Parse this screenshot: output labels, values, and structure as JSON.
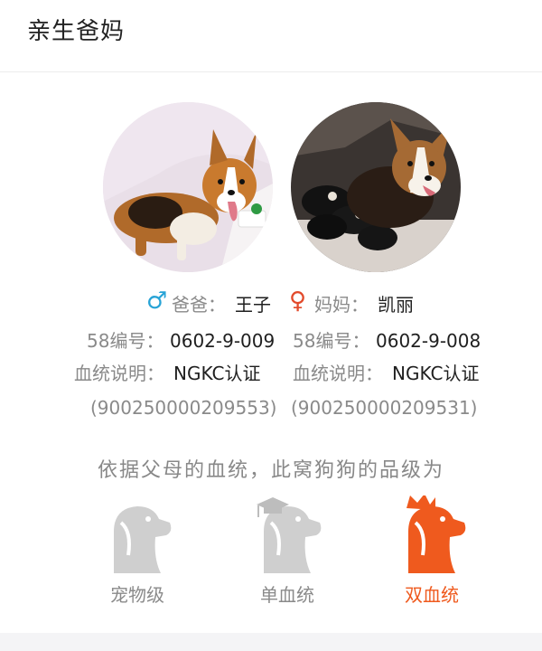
{
  "header": {
    "title": "亲生爸妈"
  },
  "parents": {
    "dad": {
      "symbol": "♂",
      "role_label": "爸爸：",
      "name": "王子",
      "id_label": "58编号：",
      "id": "0602-9-009",
      "lineage_label": "血统说明：",
      "lineage": "NGKC认证",
      "chip": "(900250000209553)"
    },
    "mom": {
      "symbol": "♀",
      "role_label": "妈妈：",
      "name": "凯丽",
      "id_label": "58编号：",
      "id": "0602-9-008",
      "lineage_label": "血统说明：",
      "lineage": "NGKC认证",
      "chip": "(900250000209531)"
    }
  },
  "grade": {
    "caption": "依据父母的血统，此窝狗狗的品级为",
    "options": [
      {
        "label": "宠物级",
        "icon": "dog-head-icon",
        "active": false
      },
      {
        "label": "单血统",
        "icon": "dog-graduate-icon",
        "active": false
      },
      {
        "label": "双血统",
        "icon": "dog-crown-icon",
        "active": true
      }
    ]
  },
  "colors": {
    "male": "#27a3d6",
    "female": "#e24a2b",
    "active": "#ef5a1e",
    "inactive": "#cfcfcf"
  }
}
